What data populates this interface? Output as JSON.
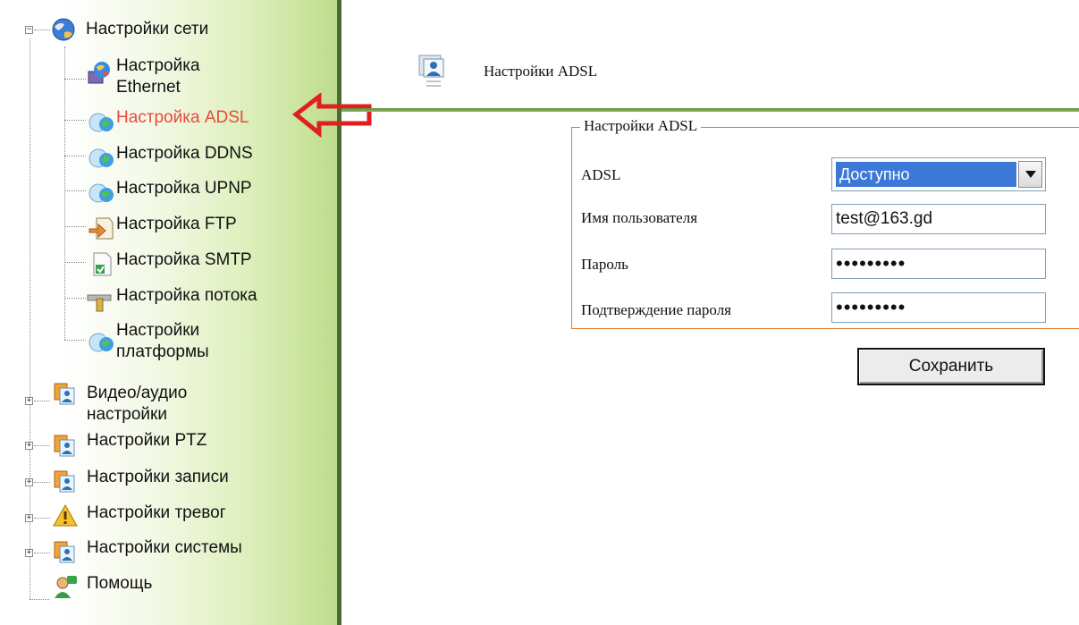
{
  "sidebar": {
    "network": {
      "label": "Настройки сети",
      "children": [
        {
          "label": "Настройка Ethernet",
          "icon": "network-globe-icon"
        },
        {
          "label": "Настройка ADSL",
          "icon": "chat-globe-icon",
          "active": true
        },
        {
          "label": "Настройка DDNS",
          "icon": "chat-globe-icon"
        },
        {
          "label": "Настройка UPNP",
          "icon": "chat-globe-icon"
        },
        {
          "label": "Настройка FTP",
          "icon": "ftp-arrow-icon"
        },
        {
          "label": "Настройка SMTP",
          "icon": "smtp-doc-icon"
        },
        {
          "label": "Настройка потока",
          "icon": "pipe-icon"
        },
        {
          "label": "Настройки платформы",
          "icon": "chat-globe-icon"
        }
      ]
    },
    "sections": [
      {
        "label": "Видео/аудио настройки",
        "icon": "user-card-icon"
      },
      {
        "label": "Настройки PTZ",
        "icon": "user-card-icon"
      },
      {
        "label": "Настройки записи",
        "icon": "user-card-icon"
      },
      {
        "label": "Настройки тревог",
        "icon": "warning-icon"
      },
      {
        "label": "Настройки системы",
        "icon": "user-card-icon"
      },
      {
        "label": "Помощь",
        "icon": "help-user-icon"
      }
    ],
    "active_color": "#e84a3c"
  },
  "main": {
    "title": "Настройки ADSL",
    "form": {
      "legend": "Настройки ADSL",
      "adsl": {
        "label": "ADSL",
        "selected": "Доступно"
      },
      "username": {
        "label": "Имя пользователя",
        "value": "test@163.gd"
      },
      "password": {
        "label": "Пароль",
        "value": "•••••••••"
      },
      "confirm": {
        "label": "Подтверждение пароля",
        "value": "•••••••••"
      },
      "save_label": "Сохранить"
    }
  },
  "colors": {
    "fieldset_border": "#e07a2a",
    "header_rule": "#6a9845",
    "select_highlight": "#3b78d8",
    "annotation_arrow": "#e02020"
  }
}
